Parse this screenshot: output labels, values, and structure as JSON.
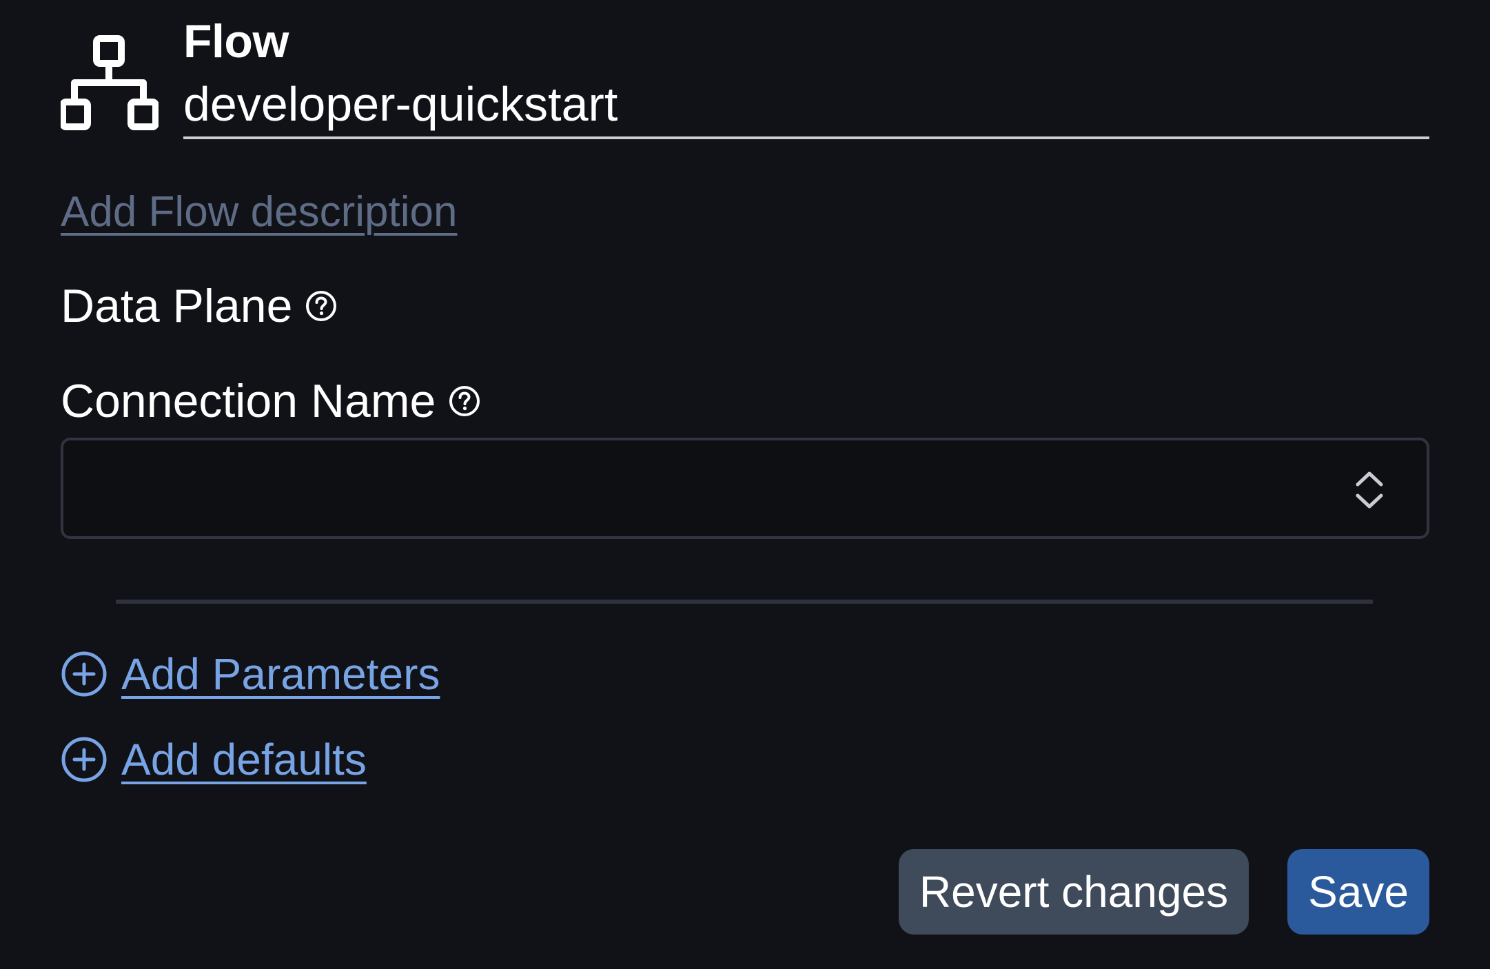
{
  "header": {
    "kind_label": "Flow",
    "name_value": "developer-quickstart",
    "icon": "flow-hierarchy-icon"
  },
  "description_link": "Add Flow description",
  "data_plane": {
    "label": "Data Plane",
    "help_icon": "question-circle-icon"
  },
  "connection_name": {
    "label": "Connection Name",
    "help_icon": "question-circle-icon",
    "selected_value": "",
    "select_icon": "chevron-up-down-icon"
  },
  "actions": {
    "add_parameters": "Add Parameters",
    "add_defaults": "Add defaults",
    "add_icon": "plus-circle-icon"
  },
  "footer": {
    "revert_label": "Revert changes",
    "save_label": "Save"
  },
  "colors": {
    "background": "#101217",
    "link_blue": "#78a4e6",
    "muted_link": "#5e6c85",
    "revert_button": "#3f4a5a",
    "save_button": "#2b5a9c"
  }
}
